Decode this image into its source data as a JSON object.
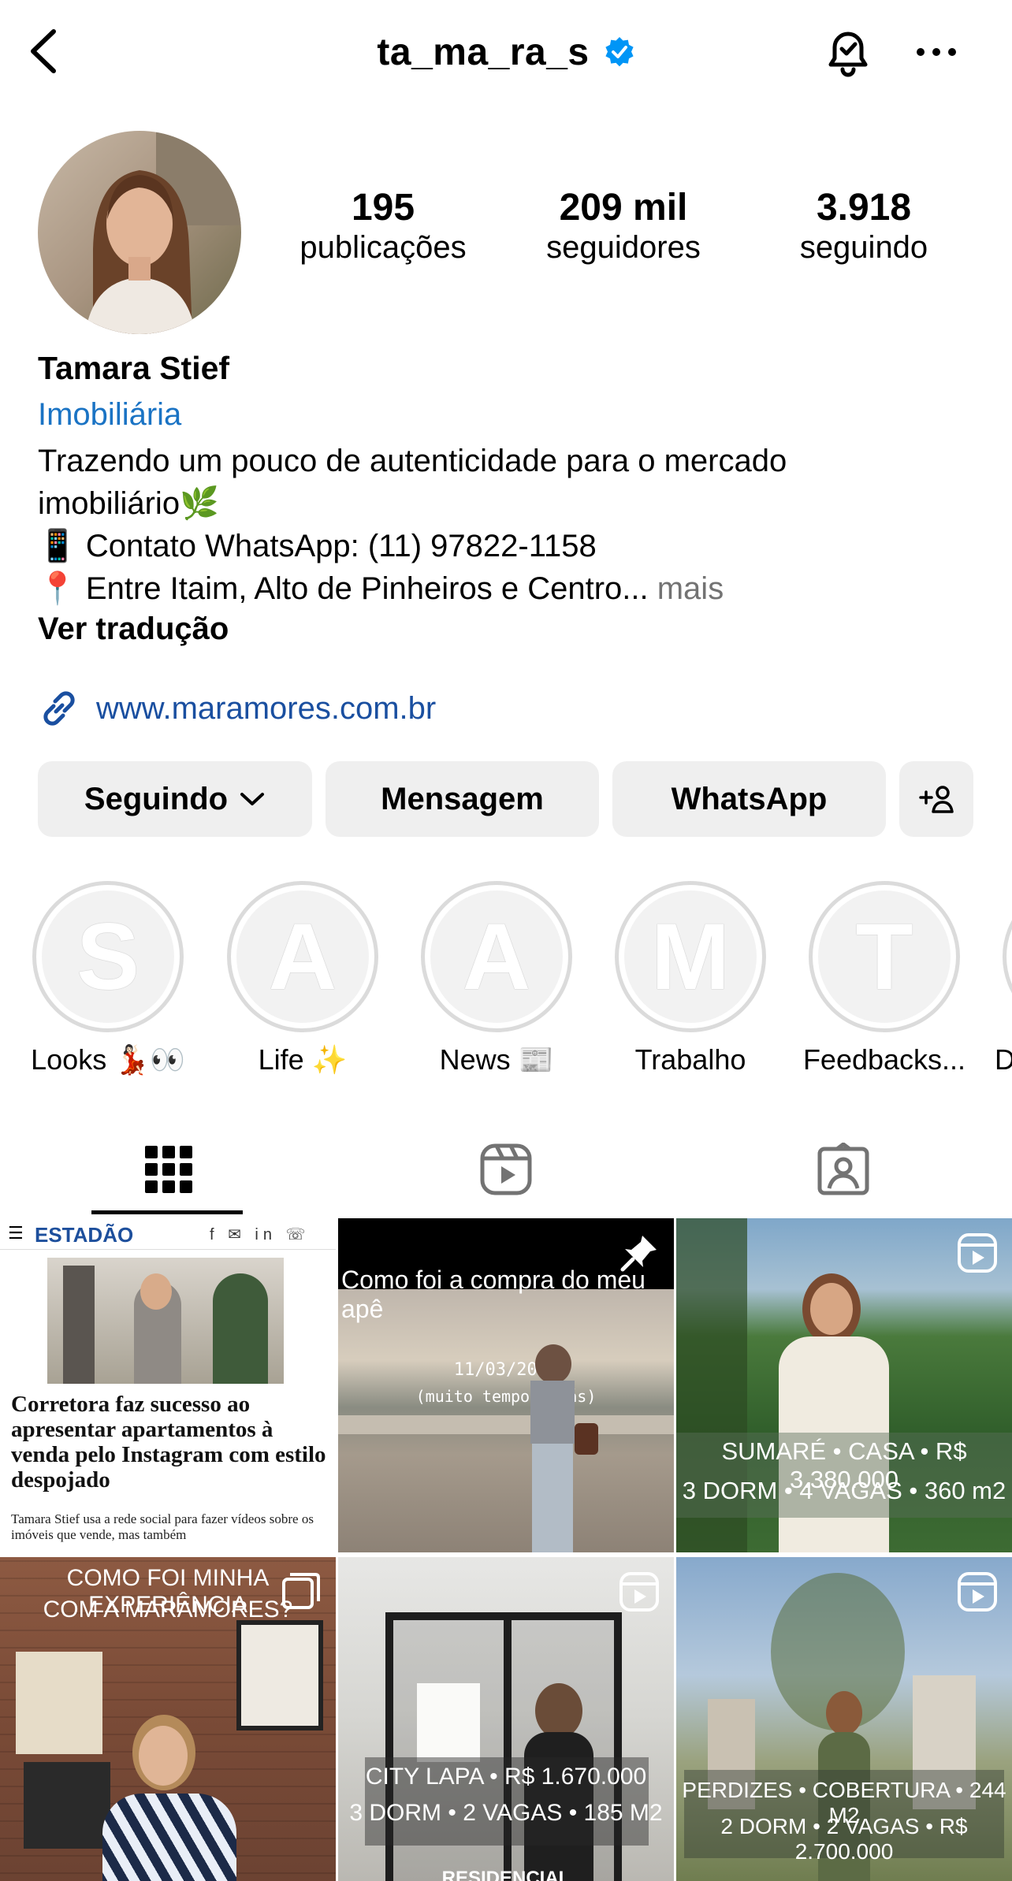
{
  "header": {
    "username": "ta_ma_ra_s",
    "icons": {
      "back": "chevron-left-icon",
      "verified": "verified-badge-icon",
      "notifications": "bell-check-icon",
      "more": "more-dots-icon"
    },
    "verified_color": "#0095f6"
  },
  "stats": [
    {
      "value": "195",
      "label": "publicações"
    },
    {
      "value": "209 mil",
      "label": "seguidores"
    },
    {
      "value": "3.918",
      "label": "seguindo"
    }
  ],
  "profile": {
    "name": "Tamara Stief",
    "category": "Imobiliária",
    "bio_line1": "Trazendo um pouco de autenticidade para o mercado",
    "bio_line2": "imobiliário🌿",
    "bio_line3": "📱 Contato WhatsApp: (11) 97822-1158",
    "bio_line4": "📍 Entre Itaim, Alto de Pinheiros e Centro...",
    "more": "mais",
    "translate": "Ver tradução",
    "website": "www.maramores.com.br"
  },
  "actions": {
    "following": "Seguindo",
    "message": "Mensagem",
    "whatsapp": "WhatsApp",
    "add_user_icon": "add-user-icon"
  },
  "highlights": [
    {
      "letter": "S",
      "label": "Looks 💃🏻👀"
    },
    {
      "letter": "A",
      "label": "Life ✨"
    },
    {
      "letter": "A",
      "label": "News 📰"
    },
    {
      "letter": "M",
      "label": "Trabalho"
    },
    {
      "letter": "T",
      "label": "Feedbacks..."
    },
    {
      "letter": "",
      "label": "D"
    }
  ],
  "tabs": [
    {
      "name": "grid",
      "icon": "grid-icon",
      "active": true
    },
    {
      "name": "reels",
      "icon": "reels-icon",
      "active": false
    },
    {
      "name": "tagged",
      "icon": "tagged-icon",
      "active": false
    }
  ],
  "posts": {
    "p1": {
      "masthead": "ESTADÃO",
      "headline": "Corretora faz sucesso ao apresentar apartamentos à venda pelo Instagram com estilo despojado",
      "snippet": "Tamara Stief usa a rede social para fazer vídeos sobre os imóveis que vende, mas também"
    },
    "p2": {
      "caption": "Como foi a compra do meu apê",
      "date": "11/03/2012",
      "date_note": "(muito tempo atrás)"
    },
    "p3": {
      "line1": "SUMARÉ • CASA • R$ 3.380.000",
      "line2": "3 DORM • 4 VAGAS • 360 m2"
    },
    "p4": {
      "line1": "COMO FOI MINHA EXPERIÊNCIA",
      "line2": "COM A MARAMORES?"
    },
    "p5": {
      "line1": "CITY LAPA • R$ 1.670.000",
      "line2": "3 DORM • 2 VAGAS • 185 M2",
      "tag": "RESIDENCIAL"
    },
    "p6": {
      "line1": "PERDIZES • COBERTURA • 244 M2",
      "line2": "2 DORM • 2 VAGAS • R$ 2.700.000"
    }
  },
  "colors": {
    "link": "#1a4fa0",
    "category": "#1a73c4",
    "button_bg": "#efefef",
    "muted": "#737373"
  }
}
